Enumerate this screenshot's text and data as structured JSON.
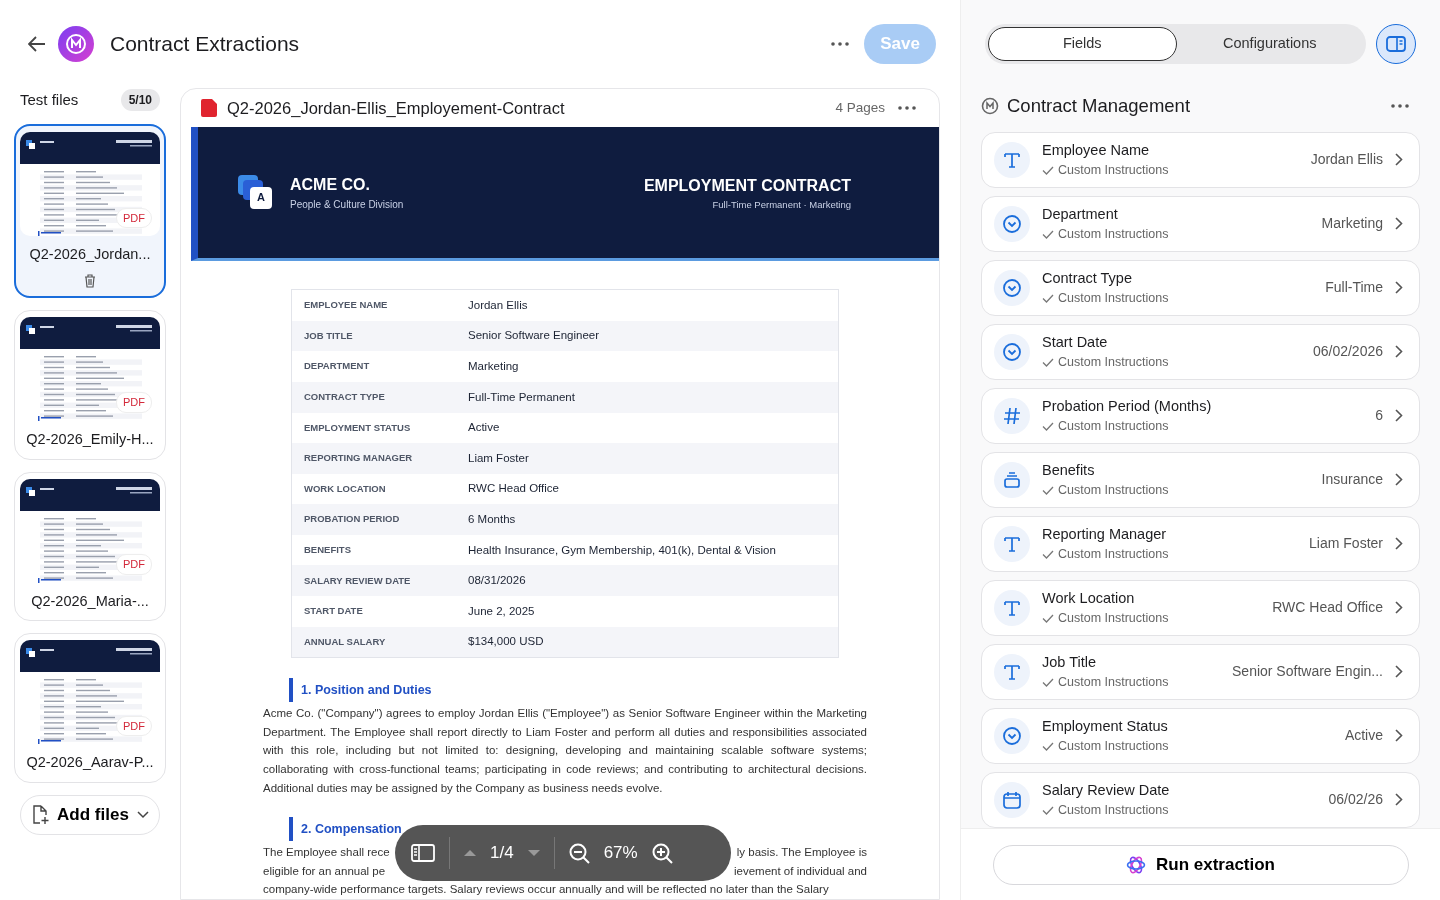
{
  "header": {
    "title": "Contract Extractions",
    "save_label": "Save",
    "save_disabled": true
  },
  "test_files": {
    "title": "Test files",
    "count": "5/10",
    "add_label": "Add files",
    "files": [
      {
        "name": "Q2-2026_Jordan...",
        "badge": "PDF",
        "selected": true
      },
      {
        "name": "Q2-2026_Emily-H...",
        "badge": "PDF",
        "selected": false
      },
      {
        "name": "Q2-2026_Maria-...",
        "badge": "PDF",
        "selected": false
      },
      {
        "name": "Q2-2026_Aarav-P...",
        "badge": "PDF",
        "selected": false
      }
    ]
  },
  "viewer": {
    "file_name": "Q2-2026_Jordan-Ellis_Employement-Contract",
    "pages": "4 Pages",
    "document": {
      "company": "ACME CO.",
      "division": "People & Culture Division",
      "logo_letter": "A",
      "doc_title": "EMPLOYMENT CONTRACT",
      "doc_subtitle": "Full-Time Permanent · Marketing",
      "table": [
        {
          "label": "EMPLOYEE NAME",
          "value": "Jordan Ellis"
        },
        {
          "label": "JOB TITLE",
          "value": "Senior Software Engineer"
        },
        {
          "label": "DEPARTMENT",
          "value": "Marketing"
        },
        {
          "label": "CONTRACT TYPE",
          "value": "Full-Time Permanent"
        },
        {
          "label": "EMPLOYMENT STATUS",
          "value": "Active"
        },
        {
          "label": "REPORTING MANAGER",
          "value": "Liam Foster"
        },
        {
          "label": "WORK LOCATION",
          "value": "RWC Head Office"
        },
        {
          "label": "PROBATION PERIOD",
          "value": "6 Months"
        },
        {
          "label": "BENEFITS",
          "value": "Health Insurance, Gym Membership, 401(k), Dental & Vision"
        },
        {
          "label": "SALARY REVIEW DATE",
          "value": "08/31/2026"
        },
        {
          "label": "START DATE",
          "value": "June 2, 2025"
        },
        {
          "label": "ANNUAL SALARY",
          "value": "$134,000 USD"
        }
      ],
      "sections": [
        {
          "heading": "1. Position and Duties",
          "paragraph": "Acme Co. (\"Company\") agrees to employ Jordan Ellis (\"Employee\") as Senior Software Engineer within the Marketing Department. The Employee shall report directly to Liam Foster and perform all duties and responsibilities associated with this role, including but not limited to: designing, developing and maintaining scalable software systems; collaborating with cross-functional teams; participating in code reviews; and contributing to architectural decisions. Additional duties may be assigned by the Company as business needs evolve."
        },
        {
          "heading": "2. Compensation",
          "lines": [
            {
              "left": "The Employee shall rece",
              "right": "ly basis. The Employee is"
            },
            {
              "left": "eligible for an annual pe",
              "right": "ievement of individual and"
            },
            {
              "left": "company-wide performance targets. Salary reviews occur annually and will be reflected no later than the Salary"
            }
          ]
        }
      ]
    },
    "toolbar": {
      "page": "1/4",
      "zoom": "67%"
    }
  },
  "side": {
    "tabs": [
      {
        "label": "Fields",
        "selected": true
      },
      {
        "label": "Configurations",
        "selected": false
      }
    ],
    "group_title": "Contract Management",
    "fields": [
      {
        "kind": "text",
        "name": "Employee Name",
        "note": "Custom Instructions",
        "value": "Jordan Ellis"
      },
      {
        "kind": "select",
        "name": "Department",
        "note": "Custom Instructions",
        "value": "Marketing"
      },
      {
        "kind": "select",
        "name": "Contract Type",
        "note": "Custom Instructions",
        "value": "Full-Time"
      },
      {
        "kind": "select",
        "name": "Start Date",
        "note": "Custom Instructions",
        "value": "06/02/2026"
      },
      {
        "kind": "number",
        "name": "Probation Period (Months)",
        "note": "Custom Instructions",
        "value": "6"
      },
      {
        "kind": "list",
        "name": "Benefits",
        "note": "Custom Instructions",
        "value": "Insurance"
      },
      {
        "kind": "text",
        "name": "Reporting Manager",
        "note": "Custom Instructions",
        "value": "Liam Foster"
      },
      {
        "kind": "text",
        "name": "Work Location",
        "note": "Custom Instructions",
        "value": "RWC Head Office"
      },
      {
        "kind": "text",
        "name": "Job Title",
        "note": "Custom Instructions",
        "value": "Senior Software Engin..."
      },
      {
        "kind": "select",
        "name": "Employment Status",
        "note": "Custom Instructions",
        "value": "Active"
      },
      {
        "kind": "date",
        "name": "Salary Review Date",
        "note": "Custom Instructions",
        "value": "06/02/26"
      }
    ],
    "run_label": "Run extraction"
  }
}
